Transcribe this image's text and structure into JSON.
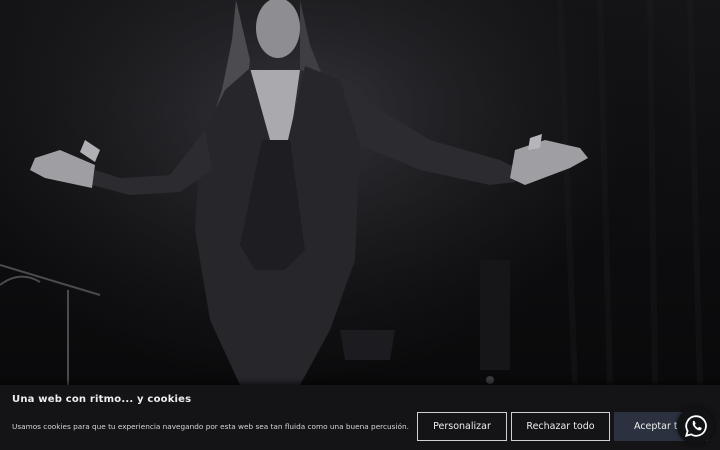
{
  "hero": {
    "image_description_icon": "performer-photo"
  },
  "cookie_banner": {
    "title": "Una web con ritmo... y cookies",
    "text": "Usamos cookies para que tu experiencia navegando por esta web sea tan fluida como una buena percusión.",
    "customize_label": "Personalizar",
    "reject_label": "Rechazar todo",
    "accept_label": "Aceptar todo"
  },
  "whatsapp": {
    "icon": "whatsapp-icon"
  },
  "colors": {
    "background": "#0a0a0b",
    "banner": "#141416",
    "accept_button": "#2c3140"
  }
}
